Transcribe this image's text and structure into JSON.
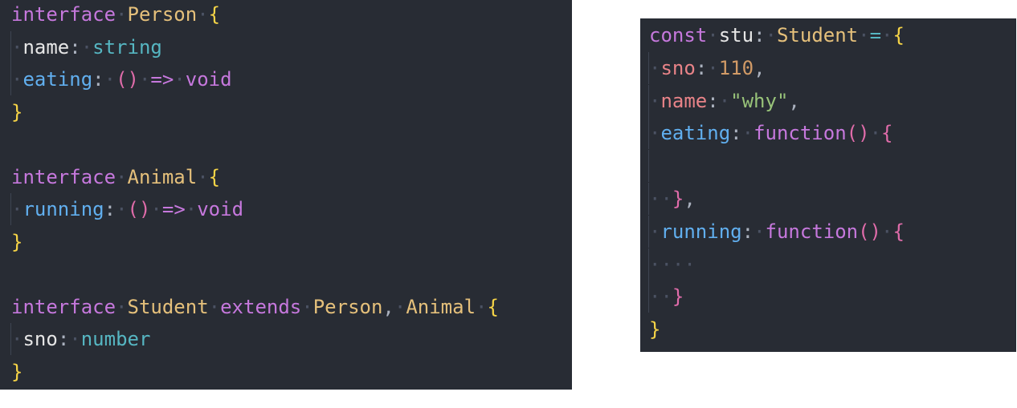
{
  "left_snippet": {
    "lines": [
      {
        "parts": [
          [
            "kw",
            "interface"
          ],
          [
            "ws",
            "·"
          ],
          [
            "type",
            "Person"
          ],
          [
            "ws",
            "·"
          ],
          [
            "brace",
            "{"
          ]
        ]
      },
      {
        "parts": [
          [
            "guide",
            ""
          ],
          [
            "ws",
            "·"
          ],
          [
            "prop",
            "name"
          ],
          [
            "punct",
            ":"
          ],
          [
            "ws",
            "·"
          ],
          [
            "tstr",
            "string"
          ]
        ]
      },
      {
        "parts": [
          [
            "guide",
            ""
          ],
          [
            "ws",
            "·"
          ],
          [
            "prop-blue",
            "eating"
          ],
          [
            "punct",
            ":"
          ],
          [
            "ws",
            "·"
          ],
          [
            "paren",
            "()"
          ],
          [
            "ws",
            "·"
          ],
          [
            "arrow",
            "=>"
          ],
          [
            "ws",
            "·"
          ],
          [
            "void",
            "void"
          ]
        ]
      },
      {
        "parts": [
          [
            "brace",
            "}"
          ]
        ]
      },
      {
        "parts": []
      },
      {
        "parts": [
          [
            "kw",
            "interface"
          ],
          [
            "ws",
            "·"
          ],
          [
            "type",
            "Animal"
          ],
          [
            "ws",
            "·"
          ],
          [
            "brace",
            "{"
          ]
        ]
      },
      {
        "parts": [
          [
            "guide",
            ""
          ],
          [
            "ws",
            "·"
          ],
          [
            "prop-blue",
            "running"
          ],
          [
            "punct",
            ":"
          ],
          [
            "ws",
            "·"
          ],
          [
            "paren",
            "()"
          ],
          [
            "ws",
            "·"
          ],
          [
            "arrow",
            "=>"
          ],
          [
            "ws",
            "·"
          ],
          [
            "void",
            "void"
          ]
        ]
      },
      {
        "parts": [
          [
            "brace",
            "}"
          ]
        ]
      },
      {
        "parts": []
      },
      {
        "parts": [
          [
            "kw",
            "interface"
          ],
          [
            "ws",
            "·"
          ],
          [
            "type",
            "Student"
          ],
          [
            "ws",
            "·"
          ],
          [
            "kw",
            "extends"
          ],
          [
            "ws",
            "·"
          ],
          [
            "type",
            "Person"
          ],
          [
            "punct",
            ","
          ],
          [
            "ws",
            "·"
          ],
          [
            "type",
            "Animal"
          ],
          [
            "ws",
            "·"
          ],
          [
            "brace",
            "{"
          ]
        ]
      },
      {
        "parts": [
          [
            "guide",
            ""
          ],
          [
            "ws",
            "·"
          ],
          [
            "prop",
            "sno"
          ],
          [
            "punct",
            ":"
          ],
          [
            "ws",
            "·"
          ],
          [
            "tstr",
            "number"
          ]
        ]
      },
      {
        "parts": [
          [
            "brace",
            "}"
          ]
        ]
      }
    ]
  },
  "right_snippet": {
    "lines": [
      {
        "parts": [
          [
            "kw",
            "const"
          ],
          [
            "ws",
            "·"
          ],
          [
            "prop",
            "stu"
          ],
          [
            "punct",
            ":"
          ],
          [
            "ws",
            "·"
          ],
          [
            "type",
            "Student"
          ],
          [
            "ws",
            "·"
          ],
          [
            "op",
            "="
          ],
          [
            "ws",
            "·"
          ],
          [
            "brace",
            "{"
          ]
        ]
      },
      {
        "parts": [
          [
            "guide",
            ""
          ],
          [
            "ws",
            "·"
          ],
          [
            "prop-red",
            "sno"
          ],
          [
            "punct",
            ":"
          ],
          [
            "ws",
            "·"
          ],
          [
            "num",
            "110"
          ],
          [
            "punct",
            ","
          ]
        ]
      },
      {
        "parts": [
          [
            "guide",
            ""
          ],
          [
            "ws",
            "·"
          ],
          [
            "prop-red",
            "name"
          ],
          [
            "punct",
            ":"
          ],
          [
            "ws",
            "·"
          ],
          [
            "str",
            "\"why\""
          ],
          [
            "punct",
            ","
          ]
        ]
      },
      {
        "parts": [
          [
            "guide",
            ""
          ],
          [
            "ws",
            "·"
          ],
          [
            "prop-blue",
            "eating"
          ],
          [
            "punct",
            ":"
          ],
          [
            "ws",
            "·"
          ],
          [
            "kw",
            "function"
          ],
          [
            "paren",
            "()"
          ],
          [
            "ws",
            "·"
          ],
          [
            "brace-pink",
            "{"
          ]
        ]
      },
      {
        "parts": [
          [
            "guide",
            ""
          ]
        ]
      },
      {
        "parts": [
          [
            "guide",
            ""
          ],
          [
            "ws",
            "··"
          ],
          [
            "brace-pink",
            "}"
          ],
          [
            "punct",
            ","
          ]
        ]
      },
      {
        "parts": [
          [
            "guide",
            ""
          ],
          [
            "ws",
            "·"
          ],
          [
            "prop-blue",
            "running"
          ],
          [
            "punct",
            ":"
          ],
          [
            "ws",
            "·"
          ],
          [
            "kw",
            "function"
          ],
          [
            "paren",
            "()"
          ],
          [
            "ws",
            "·"
          ],
          [
            "brace-pink",
            "{"
          ]
        ]
      },
      {
        "parts": [
          [
            "guide",
            ""
          ],
          [
            "ws",
            "····"
          ]
        ]
      },
      {
        "parts": [
          [
            "guide",
            ""
          ],
          [
            "ws",
            "··"
          ],
          [
            "brace-pink",
            "}"
          ]
        ]
      },
      {
        "parts": [
          [
            "brace",
            "}"
          ]
        ]
      }
    ]
  }
}
